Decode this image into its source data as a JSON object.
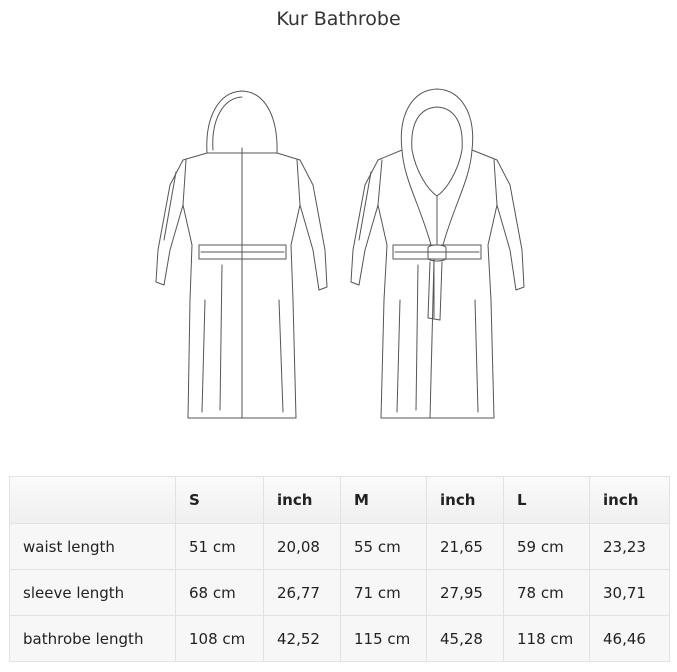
{
  "title": "Kur Bathrobe",
  "table": {
    "headers": [
      "",
      "S",
      "inch",
      "M",
      "inch",
      "L",
      "inch"
    ],
    "rows": [
      [
        "waist length",
        "51 cm",
        "20,08",
        "55 cm",
        "21,65",
        "59 cm",
        "23,23"
      ],
      [
        "sleeve length",
        "68 cm",
        "26,77",
        "71 cm",
        "27,95",
        "78 cm",
        "30,71"
      ],
      [
        "bathrobe length",
        "108 cm",
        "42,52",
        "115 cm",
        "45,28",
        "118 cm",
        "46,46"
      ]
    ]
  }
}
